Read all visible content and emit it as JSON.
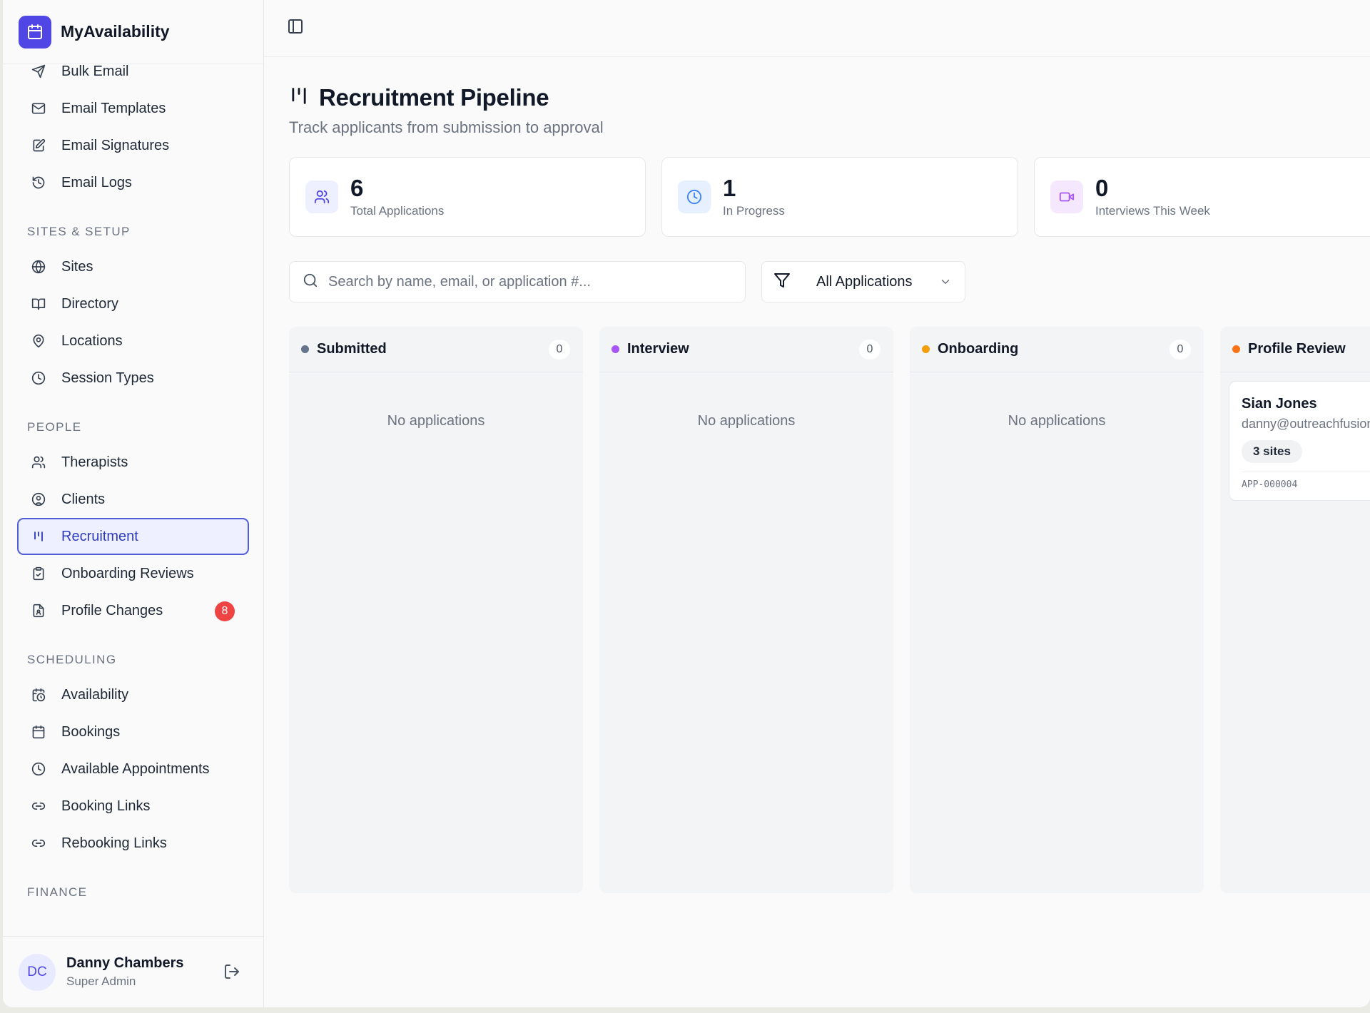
{
  "app": {
    "name": "MyAvailability"
  },
  "nav": {
    "top_items": [
      {
        "label": "Bulk Email",
        "icon": "send-icon"
      },
      {
        "label": "Email Templates",
        "icon": "mail-icon"
      },
      {
        "label": "Email Signatures",
        "icon": "signature-icon"
      },
      {
        "label": "Email Logs",
        "icon": "history-icon"
      }
    ],
    "sections": {
      "sites": "SITES & SETUP",
      "people": "PEOPLE",
      "scheduling": "SCHEDULING",
      "finance": "FINANCE"
    },
    "sites_items": [
      {
        "label": "Sites",
        "icon": "globe-icon"
      },
      {
        "label": "Directory",
        "icon": "book-icon"
      },
      {
        "label": "Locations",
        "icon": "map-pin-icon"
      },
      {
        "label": "Session Types",
        "icon": "clock-icon"
      }
    ],
    "people_items": [
      {
        "label": "Therapists",
        "icon": "users-icon"
      },
      {
        "label": "Clients",
        "icon": "user-circle-icon"
      },
      {
        "label": "Recruitment",
        "icon": "kanban-icon",
        "active": true
      },
      {
        "label": "Onboarding Reviews",
        "icon": "clipboard-check-icon"
      },
      {
        "label": "Profile Changes",
        "icon": "file-user-icon",
        "badge": "8"
      }
    ],
    "scheduling_items": [
      {
        "label": "Availability",
        "icon": "calendar-clock-icon"
      },
      {
        "label": "Bookings",
        "icon": "calendar-icon"
      },
      {
        "label": "Available Appointments",
        "icon": "clock-icon"
      },
      {
        "label": "Booking Links",
        "icon": "link-icon"
      },
      {
        "label": "Rebooking Links",
        "icon": "link-icon"
      }
    ]
  },
  "user": {
    "initials": "DC",
    "name": "Danny Chambers",
    "role": "Super Admin"
  },
  "page": {
    "title": "Recruitment Pipeline",
    "subtitle": "Track applicants from submission to approval"
  },
  "stats": [
    {
      "value": "6",
      "label": "Total Applications"
    },
    {
      "value": "1",
      "label": "In Progress"
    },
    {
      "value": "0",
      "label": "Interviews This Week"
    }
  ],
  "filters": {
    "search_placeholder": "Search by name, email, or application #...",
    "status_selected": "All Applications"
  },
  "columns": [
    {
      "title": "Submitted",
      "count": "0",
      "empty": "No applications",
      "color": "#64748b"
    },
    {
      "title": "Interview",
      "count": "0",
      "empty": "No applications",
      "color": "#a855f7"
    },
    {
      "title": "Onboarding",
      "count": "0",
      "empty": "No applications",
      "color": "#f59e0b"
    },
    {
      "title": "Profile Review",
      "color": "#f97316"
    }
  ],
  "card": {
    "name": "Sian Jones",
    "email": "danny@outreachfusion",
    "sites": "3 sites",
    "app_id": "APP-000004"
  },
  "colors": {
    "accent": "#4f46e5",
    "badge": "#ef4444"
  }
}
